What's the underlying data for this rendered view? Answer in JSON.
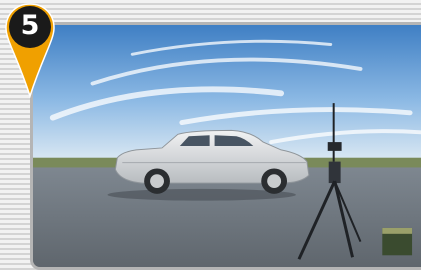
{
  "badge": {
    "number": "5",
    "pin_color": "#f0a000",
    "circle_color": "#1a1a1a"
  },
  "photo": {
    "scene": "car-on-test-track-with-tripod-instrument",
    "sky_color": "#6aa3d9",
    "car_color": "#d8dadc"
  }
}
